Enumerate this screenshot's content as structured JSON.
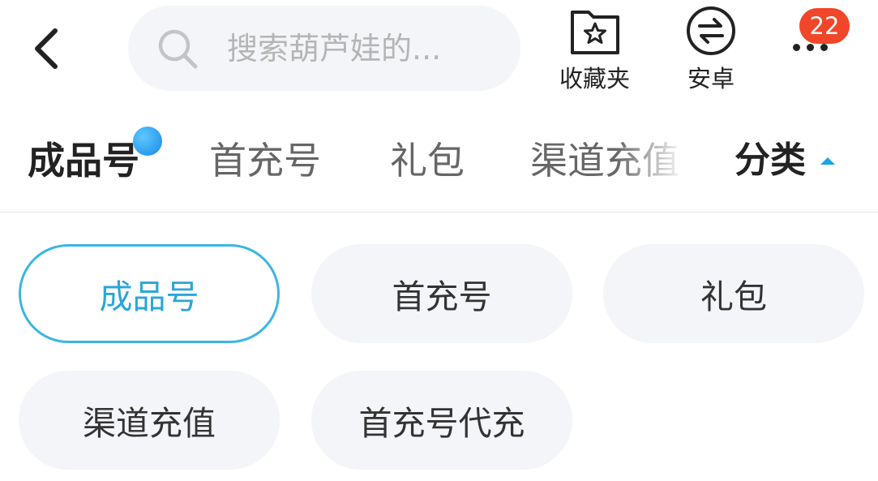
{
  "search": {
    "placeholder": "搜索葫芦娃的..."
  },
  "actions": {
    "favorites_label": "收藏夹",
    "android_label": "安卓",
    "notification_count": "22"
  },
  "tabs": [
    {
      "label": "成品号",
      "active": true
    },
    {
      "label": "首充号",
      "active": false
    },
    {
      "label": "礼包",
      "active": false
    },
    {
      "label": "渠道充值",
      "active": false
    }
  ],
  "category_toggle": {
    "label": "分类",
    "icon": "caret-up-icon"
  },
  "chips": [
    {
      "label": "成品号",
      "selected": true
    },
    {
      "label": "首充号",
      "selected": false
    },
    {
      "label": "礼包",
      "selected": false
    },
    {
      "label": "渠道充值",
      "selected": false
    },
    {
      "label": "首充号代充",
      "selected": false
    }
  ],
  "colors": {
    "accent": "#1aa4e8",
    "chip_selected_border": "#3bb6e3",
    "chip_selected_text": "#2ba6d8",
    "chip_background": "#f4f5f8",
    "badge": "#f1462a"
  }
}
